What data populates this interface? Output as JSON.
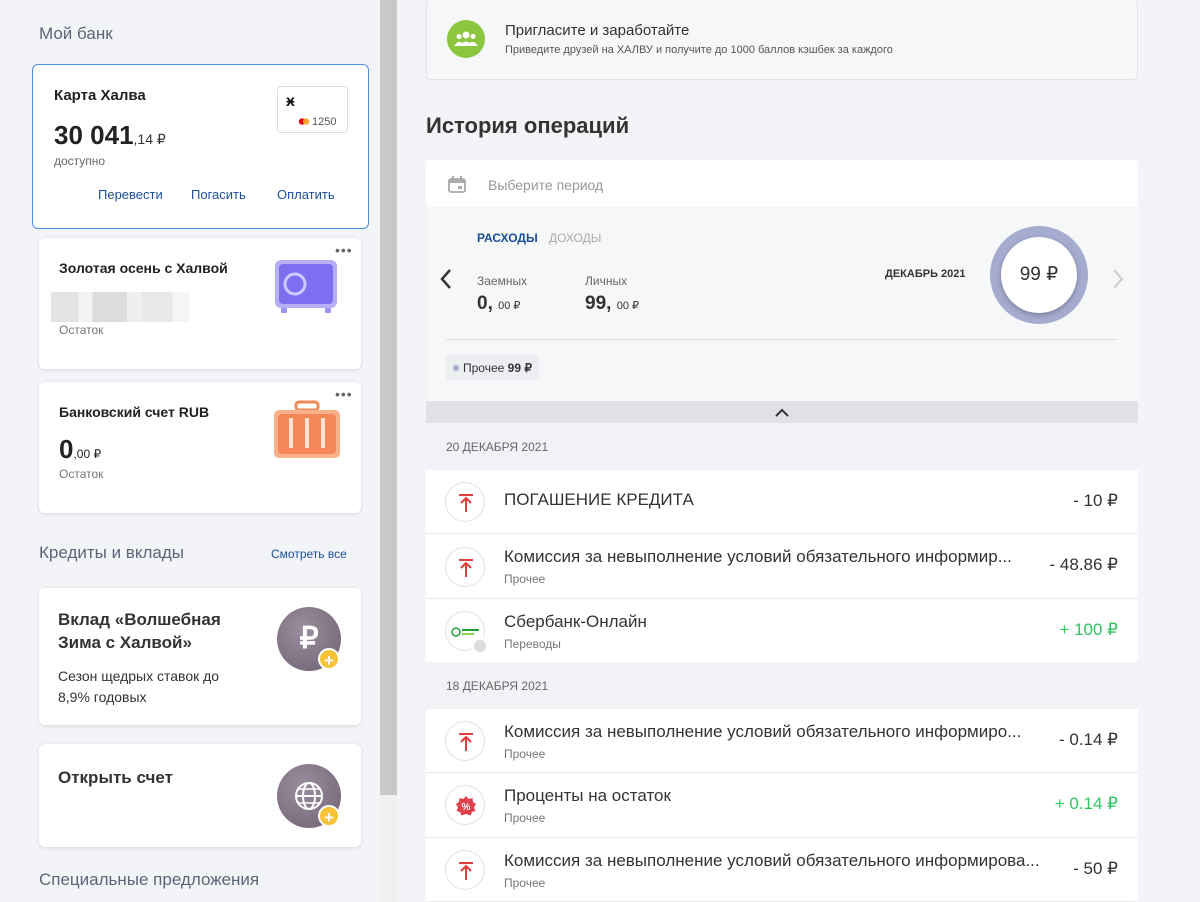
{
  "sidebar": {
    "my_bank_title": "Мой банк",
    "halva_card": {
      "title": "Карта Халва",
      "amount_main": "30 041",
      "amount_cents": ",14 ₽",
      "sub": "доступно",
      "card_last": "1250",
      "actions": [
        "Перевести",
        "Погасить",
        "Оплатить"
      ]
    },
    "autumn_card": {
      "title": "Золотая осень с Халвой",
      "sub": "Остаток"
    },
    "bank_account": {
      "title": "Банковский счет RUB",
      "amount_main": "0",
      "amount_cents": ",00 ₽",
      "sub": "Остаток"
    },
    "credits_title": "Кредиты и вклады",
    "see_all": "Смотреть все",
    "deposit": {
      "title_line1": "Вклад «Волшебная",
      "title_line2": "Зима с Халвой»",
      "desc_line1": "Сезон щедрых ставок до",
      "desc_line2": "8,9% годовых"
    },
    "open_account": {
      "title": "Открыть счет"
    },
    "special_title": "Специальные предложения"
  },
  "invite": {
    "title": "Пригласите и заработайте",
    "subtitle": "Приведите друзей на ХАЛВУ и получите до 1000 баллов кэшбек за каждого"
  },
  "history": {
    "title": "История операций",
    "period_placeholder": "Выберите период",
    "tabs": [
      "РАСХОДЫ",
      "ДОХОДЫ"
    ],
    "loan_label": "Заемных",
    "loan_value": "0,",
    "loan_cents": "00 ₽",
    "personal_label": "Личных",
    "personal_value": "99,",
    "personal_cents": "00 ₽",
    "month": "ДЕКАБРЬ 2021",
    "total": "99 ₽",
    "chip_label": "Прочее",
    "chip_value": "99 ₽"
  },
  "groups": [
    {
      "date": "20 ДЕКАБРЯ 2021",
      "ops": [
        {
          "title": "ПОГАШЕНИЕ КРЕДИТА",
          "category": "",
          "amount": "- 10 ₽",
          "icon": "arrow-up-icon"
        },
        {
          "title": "Комиссия за невыполнение условий обязательного информир...",
          "category": "Прочее",
          "amount": "- 48.86 ₽",
          "icon": "arrow-up-icon"
        },
        {
          "title": "Сбербанк-Онлайн",
          "category": "Переводы",
          "amount": "+ 100 ₽",
          "icon": "sberbank-icon"
        }
      ]
    },
    {
      "date": "18 ДЕКАБРЯ 2021",
      "ops": [
        {
          "title": "Комиссия за невыполнение условий обязательного информиро...",
          "category": "Прочее",
          "amount": "- 0.14 ₽",
          "icon": "arrow-up-icon"
        },
        {
          "title": "Проценты на остаток",
          "category": "Прочее",
          "amount": "+ 0.14 ₽",
          "icon": "percent-icon"
        },
        {
          "title": "Комиссия за невыполнение условий обязательного информирова...",
          "category": "Прочее",
          "amount": "- 50 ₽",
          "icon": "arrow-up-icon"
        }
      ]
    }
  ],
  "colors": {
    "accent": "#1a4f9c",
    "positive": "#2ec45f",
    "negative_icon": "#e23d3d",
    "donut": "#a6acd0"
  }
}
